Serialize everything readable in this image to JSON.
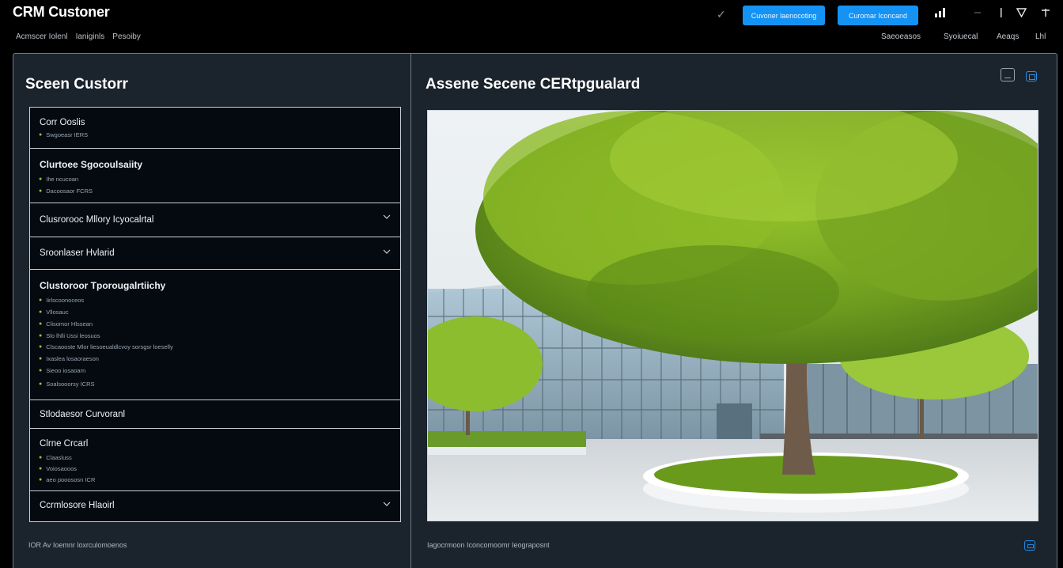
{
  "app": {
    "title": "CRM Custoner"
  },
  "subnav": [
    "Acmscer Iolenl",
    "Ianiginls",
    "Pesoiby"
  ],
  "toolbar": {
    "primary_button": "Cuvoner laenocoting",
    "secondary_button": "Curomar Iconcand"
  },
  "right_nav": [
    "Saeoeasos",
    "Syoiuecal",
    "Aeaqs",
    "Lhl"
  ],
  "left_panel": {
    "title": "Sceen Custorr",
    "items": [
      {
        "title": "Corr Ooslis",
        "bold": false,
        "subitems": [
          "Swgoeasr  IERS"
        ]
      },
      {
        "title": "Clurtoee Sgocoulsaiity",
        "bold": true,
        "subitems": [
          "Ihe ncucoan",
          "Dacoosaor  FCRS"
        ]
      },
      {
        "title": "Clusrorooc Mllory Icyocalrtal",
        "bold": false,
        "collapsed": true,
        "subitems": []
      },
      {
        "title": "Sroonlaser Hvlarid",
        "bold": false,
        "collapsed": true,
        "subitems": []
      },
      {
        "title": "Clustoroor Tporougalrtiichy",
        "bold": true,
        "subitems": [
          "Iirlscoonoceos",
          "Vllosauc",
          "Clisomor Hlssean",
          "Slo lhlli Ussi leosuos",
          "Clscaooste Mlor liesoeualdlcvoy sorsgsr loeselly",
          "Ixaslea losaoraeson",
          "Sieoo iosaoarn",
          "Soalsooorsy  ICRS"
        ]
      },
      {
        "title": "Stlodaesor Curvoranl",
        "bold": false,
        "subitems": []
      },
      {
        "title": "Clrne Crcarl",
        "bold": false,
        "subitems": [
          "Claasluss",
          "Voiosaooos",
          "aeo pooososn  ICR"
        ]
      },
      {
        "title": "Ccrmlosore Hlaoirl",
        "bold": false,
        "collapsed": true,
        "subitems": []
      }
    ],
    "footer": "IOR Av Ioemnr  loxrculomoenos"
  },
  "right_panel": {
    "title": "Assene Secene CERtpgualard",
    "footer": "Iagocrmoon Iconcomoomr  Ieograposnt"
  },
  "colors": {
    "accent": "#1493f5",
    "background": "#1b242d",
    "card": "#050a11",
    "dot": "#8bc34a"
  },
  "icons": [
    "check-icon",
    "signal-icon",
    "menu-icon",
    "divider-icon",
    "filter-icon",
    "plus-icon",
    "chevron-down-icon",
    "window-icon",
    "expand-icon"
  ]
}
